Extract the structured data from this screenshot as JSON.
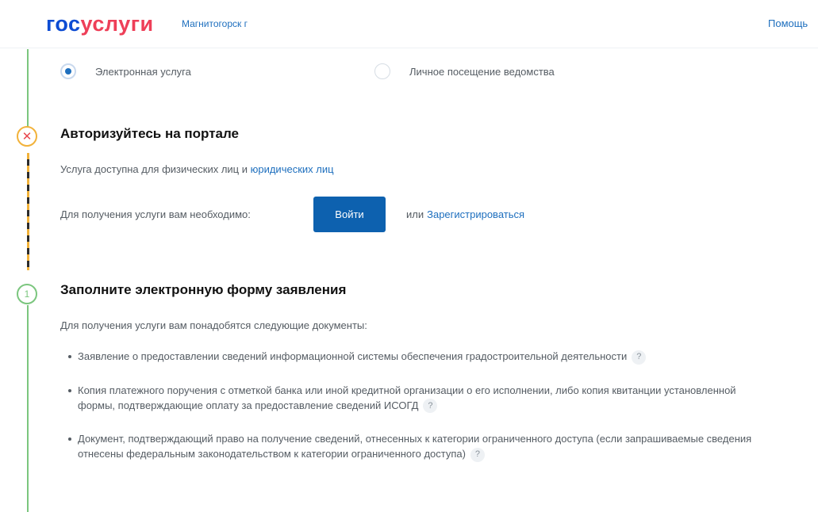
{
  "header": {
    "logo_part1": "гос",
    "logo_part2": "услуги",
    "city": "Магнитогорск г",
    "help": "Помощь"
  },
  "method": {
    "options": [
      {
        "label": "Электронная услуга",
        "selected": true
      },
      {
        "label": "Личное посещение ведомства",
        "selected": false
      }
    ]
  },
  "auth_step": {
    "icon": "x-icon",
    "title": "Авторизуйтесь на портале",
    "available_text": "Услуга доступна для физических лиц и",
    "available_link": "юридических лиц",
    "need_text": "Для получения услуги вам необходимо:",
    "login_button": "Войти",
    "or_text": "или",
    "register_link": "Зарегистрироваться"
  },
  "form_step": {
    "number": "1",
    "title": "Заполните электронную форму заявления",
    "docs_intro": "Для получения услуги вам понадобятся следующие документы:",
    "documents": [
      "Заявление о предоставлении сведений информационной системы обеспечения градостроительной деятельности",
      "Копия платежного поручения с отметкой банка или иной кредитной организации о его исполнении, либо копия квитанции установленной формы, подтверждающие оплату за предоставление сведений ИСОГД",
      "Документ, подтверждающий право на получение сведений, отнесенных к категории ограниченного доступа (если запрашиваемые сведения отнесены федеральным законодательством к категории ограниченного доступа)"
    ],
    "help_mark": "?"
  },
  "colors": {
    "brand_blue": "#0d4cd3",
    "brand_red": "#ee3f58",
    "button": "#0d61af",
    "link": "#1e6fbe",
    "success": "#7bc67e",
    "warning": "#f2b23a"
  }
}
